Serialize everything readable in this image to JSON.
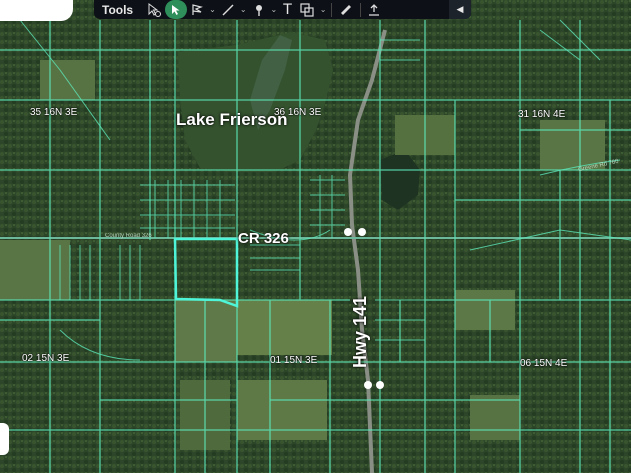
{
  "toolbar": {
    "title": "Tools",
    "icons": [
      "info-cursor-icon",
      "select-pointer-icon",
      "flag-icon",
      "line-icon",
      "pin-icon",
      "text-icon",
      "shape-icon",
      "ruler-icon",
      "upload-icon",
      "collapse-icon"
    ],
    "text_tool_glyph": "T"
  },
  "map": {
    "lake_name": "Lake Frierson",
    "roads": {
      "cr": "CR 326",
      "hwy": "Hwy 141",
      "county_road_small": "County Road 326",
      "greene_rd": "Greene Rd 760"
    },
    "sections": {
      "s35": "35 16N 3E",
      "s36": "36 16N 3E",
      "s31": "31 16N 4E",
      "s02": "02 15N 3E",
      "s01": "01 15N 3E",
      "s06": "06 15N 4E"
    },
    "colors": {
      "parcel_lines": "#5ce6b8",
      "highlight": "#4ff5d8",
      "imagery": "#2e4a2b"
    }
  }
}
